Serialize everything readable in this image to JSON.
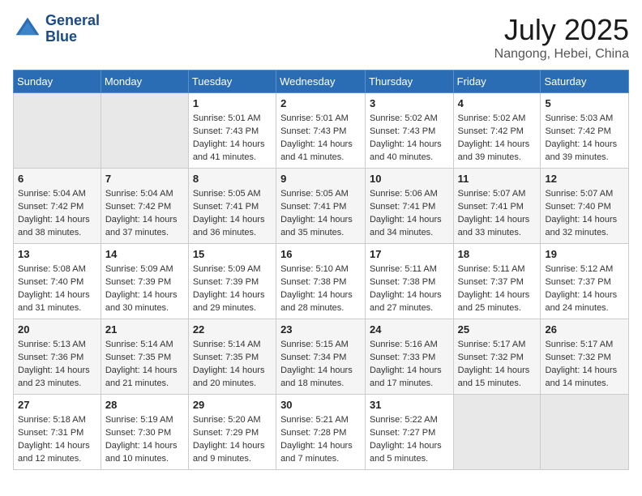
{
  "header": {
    "logo_line1": "General",
    "logo_line2": "Blue",
    "month": "July 2025",
    "location": "Nangong, Hebei, China"
  },
  "weekdays": [
    "Sunday",
    "Monday",
    "Tuesday",
    "Wednesday",
    "Thursday",
    "Friday",
    "Saturday"
  ],
  "weeks": [
    [
      {
        "day": "",
        "empty": true
      },
      {
        "day": "",
        "empty": true
      },
      {
        "day": "1",
        "sunrise": "Sunrise: 5:01 AM",
        "sunset": "Sunset: 7:43 PM",
        "daylight": "Daylight: 14 hours and 41 minutes."
      },
      {
        "day": "2",
        "sunrise": "Sunrise: 5:01 AM",
        "sunset": "Sunset: 7:43 PM",
        "daylight": "Daylight: 14 hours and 41 minutes."
      },
      {
        "day": "3",
        "sunrise": "Sunrise: 5:02 AM",
        "sunset": "Sunset: 7:43 PM",
        "daylight": "Daylight: 14 hours and 40 minutes."
      },
      {
        "day": "4",
        "sunrise": "Sunrise: 5:02 AM",
        "sunset": "Sunset: 7:42 PM",
        "daylight": "Daylight: 14 hours and 39 minutes."
      },
      {
        "day": "5",
        "sunrise": "Sunrise: 5:03 AM",
        "sunset": "Sunset: 7:42 PM",
        "daylight": "Daylight: 14 hours and 39 minutes."
      }
    ],
    [
      {
        "day": "6",
        "sunrise": "Sunrise: 5:04 AM",
        "sunset": "Sunset: 7:42 PM",
        "daylight": "Daylight: 14 hours and 38 minutes."
      },
      {
        "day": "7",
        "sunrise": "Sunrise: 5:04 AM",
        "sunset": "Sunset: 7:42 PM",
        "daylight": "Daylight: 14 hours and 37 minutes."
      },
      {
        "day": "8",
        "sunrise": "Sunrise: 5:05 AM",
        "sunset": "Sunset: 7:41 PM",
        "daylight": "Daylight: 14 hours and 36 minutes."
      },
      {
        "day": "9",
        "sunrise": "Sunrise: 5:05 AM",
        "sunset": "Sunset: 7:41 PM",
        "daylight": "Daylight: 14 hours and 35 minutes."
      },
      {
        "day": "10",
        "sunrise": "Sunrise: 5:06 AM",
        "sunset": "Sunset: 7:41 PM",
        "daylight": "Daylight: 14 hours and 34 minutes."
      },
      {
        "day": "11",
        "sunrise": "Sunrise: 5:07 AM",
        "sunset": "Sunset: 7:41 PM",
        "daylight": "Daylight: 14 hours and 33 minutes."
      },
      {
        "day": "12",
        "sunrise": "Sunrise: 5:07 AM",
        "sunset": "Sunset: 7:40 PM",
        "daylight": "Daylight: 14 hours and 32 minutes."
      }
    ],
    [
      {
        "day": "13",
        "sunrise": "Sunrise: 5:08 AM",
        "sunset": "Sunset: 7:40 PM",
        "daylight": "Daylight: 14 hours and 31 minutes."
      },
      {
        "day": "14",
        "sunrise": "Sunrise: 5:09 AM",
        "sunset": "Sunset: 7:39 PM",
        "daylight": "Daylight: 14 hours and 30 minutes."
      },
      {
        "day": "15",
        "sunrise": "Sunrise: 5:09 AM",
        "sunset": "Sunset: 7:39 PM",
        "daylight": "Daylight: 14 hours and 29 minutes."
      },
      {
        "day": "16",
        "sunrise": "Sunrise: 5:10 AM",
        "sunset": "Sunset: 7:38 PM",
        "daylight": "Daylight: 14 hours and 28 minutes."
      },
      {
        "day": "17",
        "sunrise": "Sunrise: 5:11 AM",
        "sunset": "Sunset: 7:38 PM",
        "daylight": "Daylight: 14 hours and 27 minutes."
      },
      {
        "day": "18",
        "sunrise": "Sunrise: 5:11 AM",
        "sunset": "Sunset: 7:37 PM",
        "daylight": "Daylight: 14 hours and 25 minutes."
      },
      {
        "day": "19",
        "sunrise": "Sunrise: 5:12 AM",
        "sunset": "Sunset: 7:37 PM",
        "daylight": "Daylight: 14 hours and 24 minutes."
      }
    ],
    [
      {
        "day": "20",
        "sunrise": "Sunrise: 5:13 AM",
        "sunset": "Sunset: 7:36 PM",
        "daylight": "Daylight: 14 hours and 23 minutes."
      },
      {
        "day": "21",
        "sunrise": "Sunrise: 5:14 AM",
        "sunset": "Sunset: 7:35 PM",
        "daylight": "Daylight: 14 hours and 21 minutes."
      },
      {
        "day": "22",
        "sunrise": "Sunrise: 5:14 AM",
        "sunset": "Sunset: 7:35 PM",
        "daylight": "Daylight: 14 hours and 20 minutes."
      },
      {
        "day": "23",
        "sunrise": "Sunrise: 5:15 AM",
        "sunset": "Sunset: 7:34 PM",
        "daylight": "Daylight: 14 hours and 18 minutes."
      },
      {
        "day": "24",
        "sunrise": "Sunrise: 5:16 AM",
        "sunset": "Sunset: 7:33 PM",
        "daylight": "Daylight: 14 hours and 17 minutes."
      },
      {
        "day": "25",
        "sunrise": "Sunrise: 5:17 AM",
        "sunset": "Sunset: 7:32 PM",
        "daylight": "Daylight: 14 hours and 15 minutes."
      },
      {
        "day": "26",
        "sunrise": "Sunrise: 5:17 AM",
        "sunset": "Sunset: 7:32 PM",
        "daylight": "Daylight: 14 hours and 14 minutes."
      }
    ],
    [
      {
        "day": "27",
        "sunrise": "Sunrise: 5:18 AM",
        "sunset": "Sunset: 7:31 PM",
        "daylight": "Daylight: 14 hours and 12 minutes."
      },
      {
        "day": "28",
        "sunrise": "Sunrise: 5:19 AM",
        "sunset": "Sunset: 7:30 PM",
        "daylight": "Daylight: 14 hours and 10 minutes."
      },
      {
        "day": "29",
        "sunrise": "Sunrise: 5:20 AM",
        "sunset": "Sunset: 7:29 PM",
        "daylight": "Daylight: 14 hours and 9 minutes."
      },
      {
        "day": "30",
        "sunrise": "Sunrise: 5:21 AM",
        "sunset": "Sunset: 7:28 PM",
        "daylight": "Daylight: 14 hours and 7 minutes."
      },
      {
        "day": "31",
        "sunrise": "Sunrise: 5:22 AM",
        "sunset": "Sunset: 7:27 PM",
        "daylight": "Daylight: 14 hours and 5 minutes."
      },
      {
        "day": "",
        "empty": true
      },
      {
        "day": "",
        "empty": true
      }
    ]
  ]
}
